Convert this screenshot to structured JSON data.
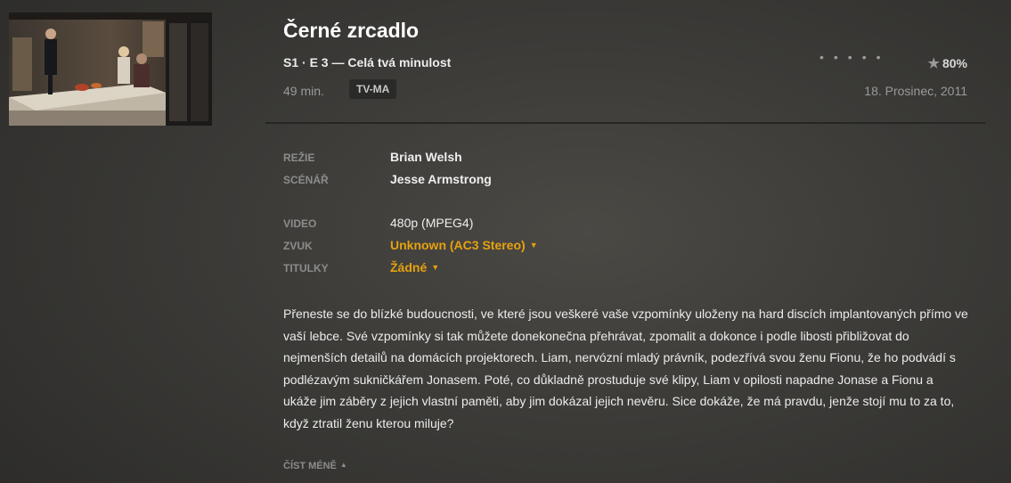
{
  "title": "Černé zrcadlo",
  "episode": "S1 · E 3 — Celá tvá minulost",
  "rating": {
    "stars_filled": 0,
    "stars_total": 5,
    "dots": "•••••",
    "star_symbol": "★",
    "percent": "80%"
  },
  "duration": "49 min.",
  "content_rating": "TV-MA",
  "air_date": "18. Prosinec, 2011",
  "credits": {
    "directed_label": "REŽIE",
    "directed_value": "Brian Welsh",
    "written_label": "SCÉNÁŘ",
    "written_value": "Jesse Armstrong"
  },
  "media": {
    "video_label": "VIDEO",
    "video_value": "480p (MPEG4)",
    "audio_label": "ZVUK",
    "audio_value": "Unknown (AC3 Stereo)",
    "subtitles_label": "TITULKY",
    "subtitles_value": "Žádné",
    "caret_down": "▼"
  },
  "summary": "Přeneste se do blízké budoucnosti, ve které jsou veškeré vaše vzpomínky uloženy na hard discích implantovaných přímo ve vaší lebce. Své vzpomínky si tak můžete donekonečna přehrávat, zpomalit a dokonce i podle libosti přibližovat do nejmenších detailů na domácích projektorech. Liam, nervózní mladý právník, podezřívá svou ženu Fionu, že ho podvádí s podlézavým sukničkářem Jonasem. Poté, co důkladně prostuduje své klipy, Liam v opilosti napadne Jonase a Fionu a ukáže jim záběry z jejich vlastní paměti, aby jim dokázal jejich nevěru. Sice dokáže, že má pravdu, jenže stojí mu to za to, když ztratil ženu kterou miluje?",
  "read_less": {
    "label": "ČÍST MÉNĚ",
    "caret_up": "▲"
  },
  "colors": {
    "accent": "#e6a20f",
    "label_gray": "#8c8c8c",
    "text": "#ececec"
  },
  "thumbnail": {
    "icon": "episode-still-image"
  }
}
